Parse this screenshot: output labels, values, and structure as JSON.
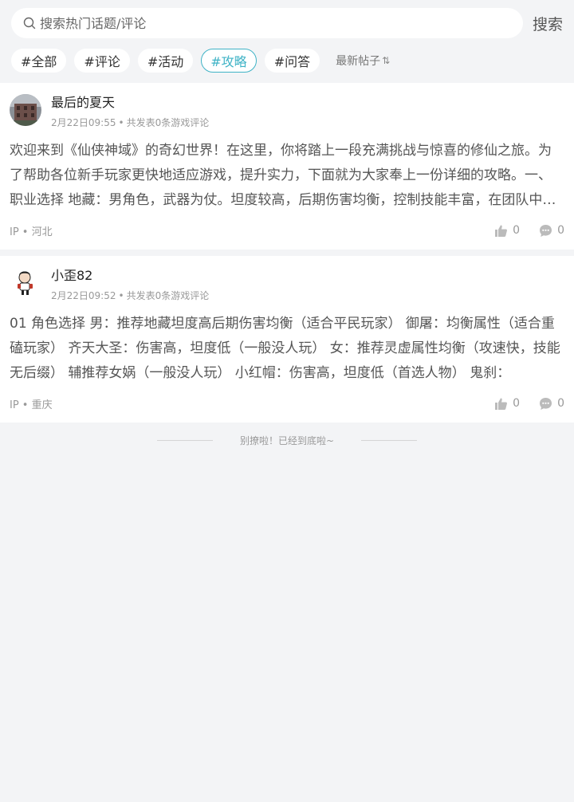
{
  "search": {
    "placeholder": "搜索热门话题/评论",
    "button_label": "搜索"
  },
  "tags": [
    {
      "label": "#全部",
      "active": false
    },
    {
      "label": "#评论",
      "active": false
    },
    {
      "label": "#活动",
      "active": false
    },
    {
      "label": "#攻略",
      "active": true
    },
    {
      "label": "#问答",
      "active": false
    }
  ],
  "sort": {
    "label": "最新帖子",
    "icon": "sort-arrows-icon"
  },
  "posts": [
    {
      "author": "最后的夏天",
      "time": "2月22日09:55",
      "meta": "共发表0条游戏评论",
      "body": "欢迎来到《仙侠神域》的奇幻世界！在这里，你将踏上一段充满挑战与惊喜的修仙之旅。为了帮助各位新手玩家更快地适应游戏，提升实力，下面就为大家奉上一份详细的攻略。一、职业选择 地藏：男角色，武器为仗。坦度较高，后期伤害均衡，控制技能丰富，在团队中能够发挥重要作用。",
      "ip": "IP • 河北",
      "likes": "0",
      "comments": "0"
    },
    {
      "author": "小歪82",
      "time": "2月22日09:52",
      "meta": "共发表0条游戏评论",
      "body": "01 角色选择 男：推荐地藏坦度高后期伤害均衡（适合平民玩家） 御屠：均衡属性（适合重磕玩家） 齐天大圣：伤害高，坦度低（一般没人玩） 女：推荐灵虚属性均衡（攻速快，技能无后缀） 辅推荐女娲（一般没人玩） 小红帽：伤害高，坦度低（首选人物） 鬼刹：",
      "ip": "IP • 重庆",
      "likes": "0",
      "comments": "0"
    }
  ],
  "footer": {
    "end_text": "别撩啦！已经到底啦~"
  },
  "colors": {
    "accent": "#3fb3c6",
    "background": "#f3f4f6"
  }
}
